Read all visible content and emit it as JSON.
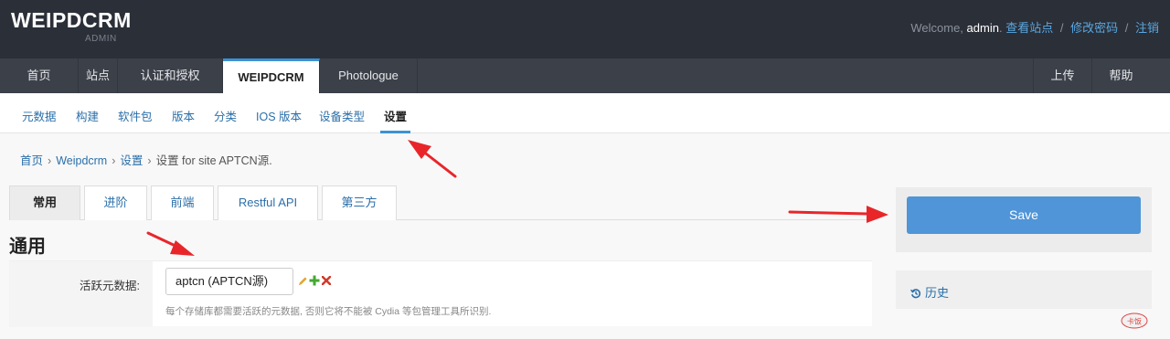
{
  "header": {
    "brand": "WEIPDCRM",
    "brand_sub": "ADMIN",
    "welcome": "Welcome, ",
    "username": "admin",
    "username_suffix": ".",
    "links": [
      "查看站点",
      "修改密码",
      "注销"
    ],
    "separator": "/"
  },
  "mainnav": {
    "items": [
      "首页",
      "站点",
      "认证和授权",
      "WEIPDCRM",
      "Photologue"
    ],
    "active": "WEIPDCRM",
    "right_items": [
      "上传",
      "帮助"
    ]
  },
  "subnav": {
    "items": [
      "元数据",
      "构建",
      "软件包",
      "版本",
      "分类",
      "IOS 版本",
      "设备类型",
      "设置"
    ],
    "active": "设置"
  },
  "breadcrumb": {
    "links": [
      "首页",
      "Weipdcrm",
      "设置"
    ],
    "current": "设置 for site APTCN源.",
    "separator": "›"
  },
  "tabs": [
    "常用",
    "进阶",
    "前端",
    "Restful API",
    "第三方"
  ],
  "active_tab": "常用",
  "section_title": "通用",
  "form": {
    "label": "活跃元数据:",
    "selected_value": "aptcn (APTCN源)",
    "help": "每个存储库都需要活跃的元数据, 否则它将不能被 Cydia 等包管理工具所识别."
  },
  "sidebar": {
    "save_label": "Save",
    "history_label": "历史"
  },
  "watermark_text": "卡饭",
  "colors": {
    "header_bg": "#2b2f38",
    "nav_bg": "#3c4049",
    "accent": "#3d92d6",
    "link": "#2b6fa9",
    "save_button": "#4f95d8",
    "annotation_arrow": "#e8262a"
  }
}
